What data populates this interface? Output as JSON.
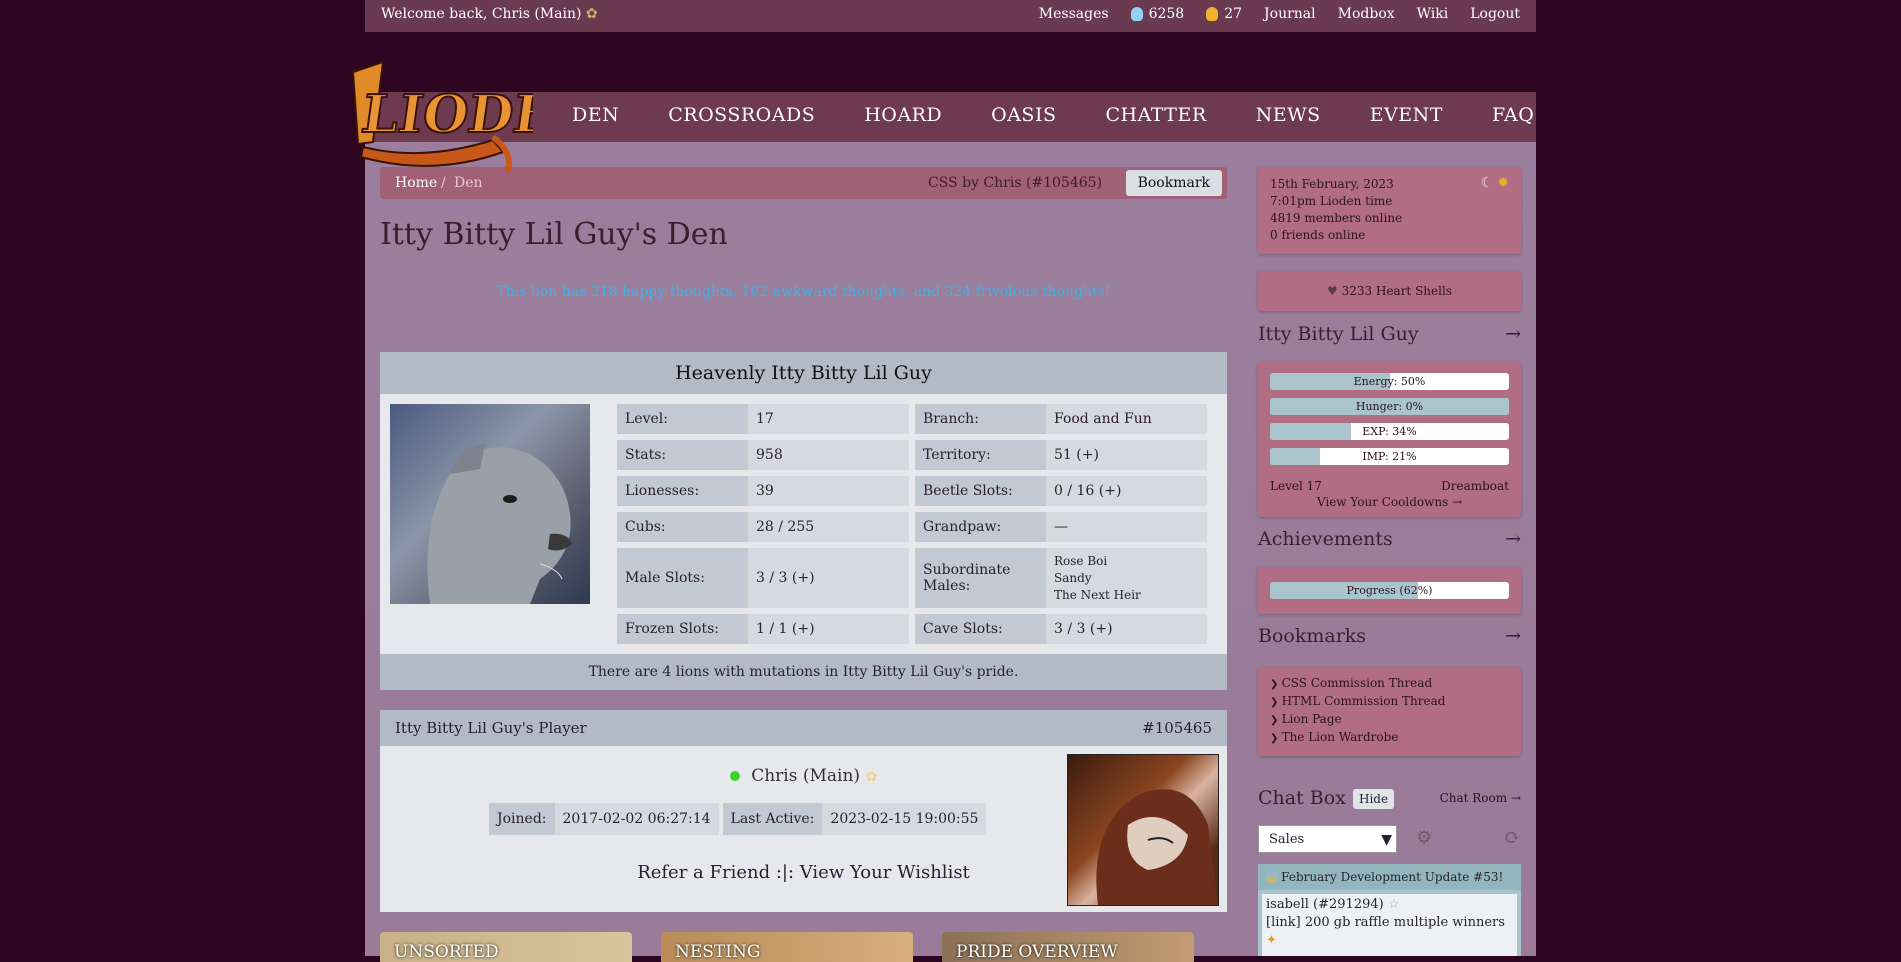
{
  "topbar": {
    "welcome": "Welcome back, Chris (Main)",
    "messages": "Messages",
    "gems_blue": "6258",
    "gems_gold": "27",
    "journal": "Journal",
    "modbox": "Modbox",
    "wiki": "Wiki",
    "logout": "Logout"
  },
  "logo": {
    "text": "LIODEN"
  },
  "nav": [
    "DEN",
    "CROSSROADS",
    "HOARD",
    "OASIS",
    "CHATTER",
    "NEWS",
    "EVENT",
    "FAQ"
  ],
  "breadcrumb": {
    "home": "Home",
    "sep": "/",
    "current": "Den",
    "css_credit": "CSS by Chris (#105465)",
    "bookmark": "Bookmark"
  },
  "den_title": "Itty Bitty Lil Guy's Den",
  "thoughts": "This lion has 218 happy thoughts, 102 awkward thoughts, and 324 frivolous thoughts!",
  "lion": {
    "heading": "Heavenly Itty Bitty Lil Guy",
    "stats": [
      {
        "k": "Level:",
        "v": "17"
      },
      {
        "k": "Branch:",
        "v": "Food and Fun"
      },
      {
        "k": "Stats:",
        "v": "958"
      },
      {
        "k": "Territory:",
        "v": "51 (+)"
      },
      {
        "k": "Lionesses:",
        "v": "39"
      },
      {
        "k": "Beetle Slots:",
        "v": "0 / 16 (+)"
      },
      {
        "k": "Cubs:",
        "v": "28 / 255"
      },
      {
        "k": "Grandpaw:",
        "v": "—"
      },
      {
        "k": "Male Slots:",
        "v": "3 / 3 (+)"
      },
      {
        "k": "Subordinate Males:",
        "v": [
          "Rose Boi",
          "Sandy",
          "The Next Heir"
        ]
      },
      {
        "k": "Frozen Slots:",
        "v": "1 / 1 (+)"
      },
      {
        "k": "Cave Slots:",
        "v": "3 / 3 (+)"
      }
    ],
    "mutations": "There are 4 lions with mutations in Itty Bitty Lil Guy's pride."
  },
  "player": {
    "heading": "Itty Bitty Lil Guy's Player",
    "id": "#105465",
    "name": "Chris (Main)",
    "joined_label": "Joined:",
    "joined": "2017-02-02 06:27:14",
    "active_label": "Last Active:",
    "active": "2023-02-15 19:00:55",
    "refer": "Refer a Friend :|: View Your Wishlist"
  },
  "tiles": [
    "UNSORTED",
    "NESTING",
    "PRIDE OVERVIEW"
  ],
  "sidebar": {
    "date": "15th February, 2023",
    "time": "7:01pm Lioden time",
    "members": "4819 members online",
    "friends": "0 friends online",
    "heart_shells": "3233 Heart Shells",
    "lion_title": "Itty Bitty Lil Guy",
    "arrow": "→",
    "bars": [
      {
        "label": "Energy: 50%",
        "fraction": 0.5
      },
      {
        "label": "Hunger: 0%",
        "fraction": 1.0
      },
      {
        "label": "EXP: 34%",
        "fraction": 0.34
      },
      {
        "label": "IMP: 21%",
        "fraction": 0.21
      }
    ],
    "level": "Level 17",
    "dreamboat": "Dreamboat",
    "cooldowns": "View Your Cooldowns →",
    "achievements_title": "Achievements",
    "progress": {
      "label": "Progress (62%)",
      "fraction": 0.62
    },
    "bookmarks_title": "Bookmarks",
    "bookmarks": [
      "CSS Commission Thread",
      "HTML Commission Thread",
      "Lion Page",
      "The Lion Wardrobe"
    ],
    "chat_title": "Chat Box",
    "hide": "Hide",
    "chat_room": "Chat Room →",
    "chat_select": "Sales",
    "announcement": "February Development Update #53! [link]",
    "chat_user": "isabell (#291294)",
    "chat_msg": "[link] 200 gb raffle multiple winners"
  },
  "colors": {
    "accent": "#a06076",
    "bg": "#2e0520",
    "link": "#3bb4e8"
  }
}
